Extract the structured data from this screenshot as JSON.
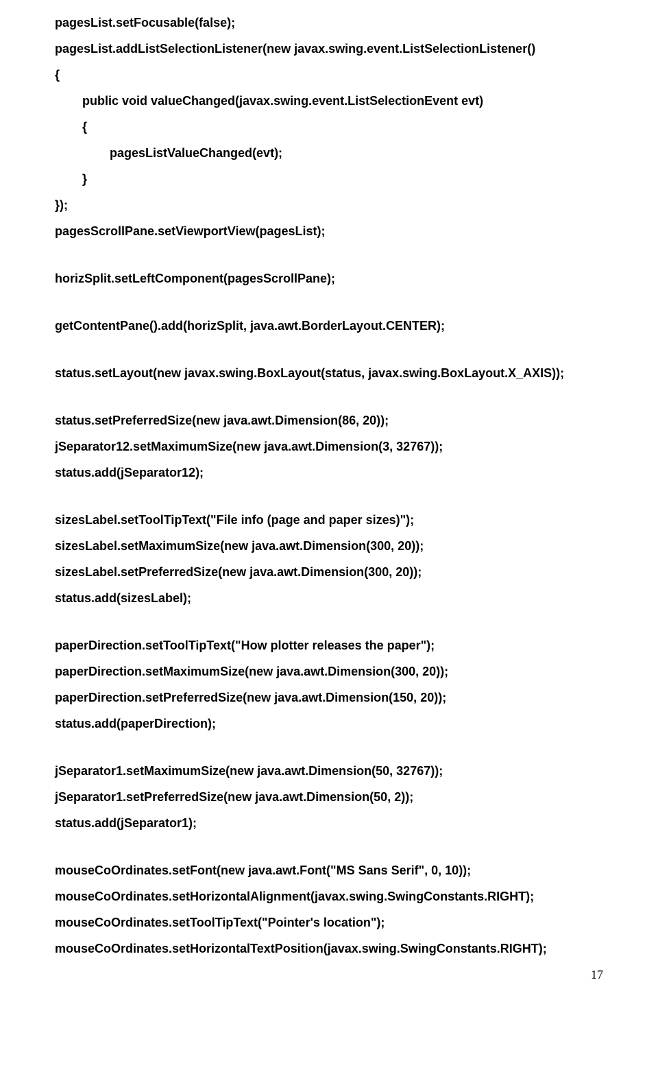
{
  "lines": [
    {
      "text": "pagesList.setFocusable(false);",
      "indent": 0,
      "gap": "small"
    },
    {
      "text": "pagesList.addListSelectionListener(new javax.swing.event.ListSelectionListener()",
      "indent": 0,
      "gap": "small"
    },
    {
      "text": "{",
      "indent": 0,
      "gap": "small"
    },
    {
      "text": "public void valueChanged(javax.swing.event.ListSelectionEvent evt)",
      "indent": 1,
      "gap": "small"
    },
    {
      "text": "{",
      "indent": 1,
      "gap": "small"
    },
    {
      "text": "pagesListValueChanged(evt);",
      "indent": 2,
      "gap": "small"
    },
    {
      "text": "}",
      "indent": 1,
      "gap": "small"
    },
    {
      "text": "});",
      "indent": 0,
      "gap": "small"
    },
    {
      "text": "pagesScrollPane.setViewportView(pagesList);",
      "indent": 0,
      "gap": "para"
    },
    {
      "text": "horizSplit.setLeftComponent(pagesScrollPane);",
      "indent": 0,
      "gap": "para"
    },
    {
      "text": "getContentPane().add(horizSplit, java.awt.BorderLayout.CENTER);",
      "indent": 0,
      "gap": "para"
    },
    {
      "text": "status.setLayout(new javax.swing.BoxLayout(status, javax.swing.BoxLayout.X_AXIS));",
      "indent": 0,
      "gap": "para"
    },
    {
      "text": "status.setPreferredSize(new java.awt.Dimension(86, 20));",
      "indent": 0,
      "gap": "small"
    },
    {
      "text": "jSeparator12.setMaximumSize(new java.awt.Dimension(3, 32767));",
      "indent": 0,
      "gap": "small"
    },
    {
      "text": "status.add(jSeparator12);",
      "indent": 0,
      "gap": "para"
    },
    {
      "text": "sizesLabel.setToolTipText(\"File info (page and paper sizes)\");",
      "indent": 0,
      "gap": "small"
    },
    {
      "text": "sizesLabel.setMaximumSize(new java.awt.Dimension(300, 20));",
      "indent": 0,
      "gap": "small"
    },
    {
      "text": "sizesLabel.setPreferredSize(new java.awt.Dimension(300, 20));",
      "indent": 0,
      "gap": "small"
    },
    {
      "text": "status.add(sizesLabel);",
      "indent": 0,
      "gap": "para"
    },
    {
      "text": "paperDirection.setToolTipText(\"How plotter releases the paper\");",
      "indent": 0,
      "gap": "small"
    },
    {
      "text": "paperDirection.setMaximumSize(new java.awt.Dimension(300, 20));",
      "indent": 0,
      "gap": "small"
    },
    {
      "text": "paperDirection.setPreferredSize(new java.awt.Dimension(150, 20));",
      "indent": 0,
      "gap": "small"
    },
    {
      "text": "status.add(paperDirection);",
      "indent": 0,
      "gap": "para"
    },
    {
      "text": "jSeparator1.setMaximumSize(new java.awt.Dimension(50, 32767));",
      "indent": 0,
      "gap": "small"
    },
    {
      "text": "jSeparator1.setPreferredSize(new java.awt.Dimension(50, 2));",
      "indent": 0,
      "gap": "small"
    },
    {
      "text": "status.add(jSeparator1);",
      "indent": 0,
      "gap": "para"
    },
    {
      "text": "mouseCoOrdinates.setFont(new java.awt.Font(\"MS Sans Serif\", 0, 10));",
      "indent": 0,
      "gap": "small"
    },
    {
      "text": "mouseCoOrdinates.setHorizontalAlignment(javax.swing.SwingConstants.RIGHT);",
      "indent": 0,
      "gap": "small"
    },
    {
      "text": "mouseCoOrdinates.setToolTipText(\"Pointer's location\");",
      "indent": 0,
      "gap": "small"
    },
    {
      "text": "mouseCoOrdinates.setHorizontalTextPosition(javax.swing.SwingConstants.RIGHT);",
      "indent": 0,
      "gap": "small"
    }
  ],
  "pageNumber": "17"
}
